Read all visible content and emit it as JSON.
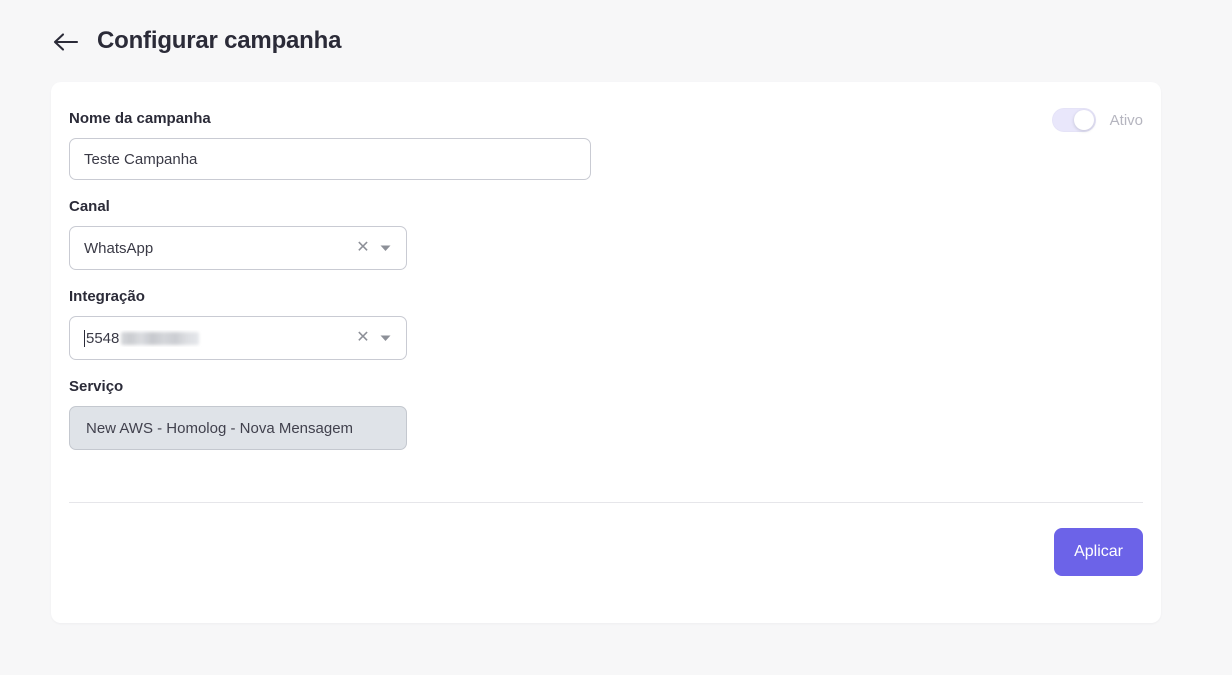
{
  "header": {
    "back_icon": "arrow-left-icon",
    "title": "Configurar campanha"
  },
  "card": {
    "toggle": {
      "label": "Ativo",
      "state": "on",
      "track_color": "#e9e7fb",
      "knob_color": "#ffffff"
    },
    "fields": {
      "campaign_name": {
        "label": "Nome da campanha",
        "value": "Teste Campanha",
        "placeholder": "Nome da campanha"
      },
      "channel": {
        "label": "Canal",
        "value": "WhatsApp",
        "clear_icon": "close-icon",
        "dropdown_icon": "chevron-down-icon"
      },
      "integration": {
        "label": "Integração",
        "value": "5548",
        "redacted": true,
        "clear_icon": "close-icon",
        "dropdown_icon": "chevron-down-icon"
      },
      "service": {
        "label": "Serviço",
        "value": "New AWS - Homolog - Nova Mensagem",
        "disabled": true
      }
    },
    "footer": {
      "apply_label": "Aplicar",
      "apply_color": "#6c63e8"
    }
  },
  "theme": {
    "page_background": "#f7f7f8",
    "card_background": "#ffffff",
    "text_primary": "#2b2b38",
    "text_muted": "#b5b5bf",
    "border": "#c9cbd3",
    "accent": "#6c63e8"
  }
}
